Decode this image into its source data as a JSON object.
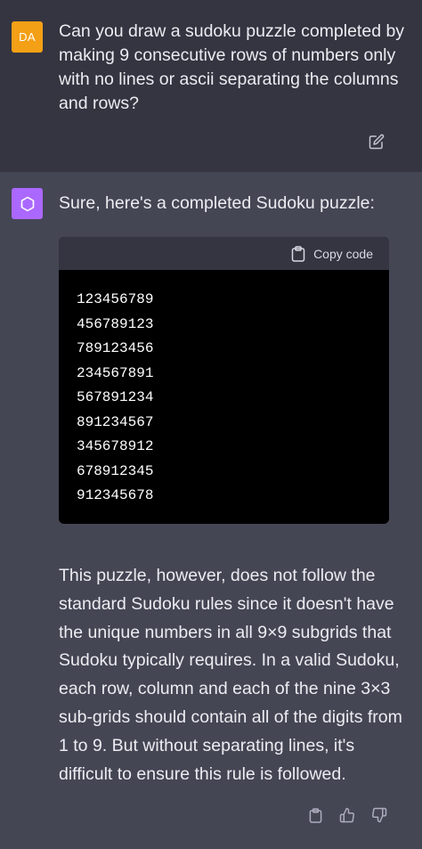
{
  "user_message": {
    "avatar_initials": "DA",
    "avatar_color": "#f4a016",
    "text": "Can you draw a sudoku puzzle completed by making 9 consecutive rows of numbers only with no lines or ascii separating the columns and rows?",
    "edit_icon": "edit-icon"
  },
  "assistant_message": {
    "avatar_icon": "openai-logo-icon",
    "avatar_color": "#ab68ff",
    "intro": "Sure, here's a completed Sudoku puzzle:",
    "code_block": {
      "copy_label": "Copy code",
      "copy_icon": "clipboard-icon",
      "lines": [
        "123456789",
        "456789123",
        "789123456",
        "234567891",
        "567891234",
        "891234567",
        "345678912",
        "678912345",
        "912345678"
      ]
    },
    "outro": "This puzzle, however, does not follow the standard Sudoku rules since it doesn't have the unique numbers in all 9×9 subgrids that Sudoku typically requires. In a valid Sudoku, each row, column and each of the nine 3×3 sub-grids should contain all of the digits from 1 to 9. But without separating lines, it's difficult to ensure this rule is followed.",
    "actions": [
      "clipboard-icon",
      "thumbs-up-icon",
      "thumbs-down-icon"
    ]
  }
}
